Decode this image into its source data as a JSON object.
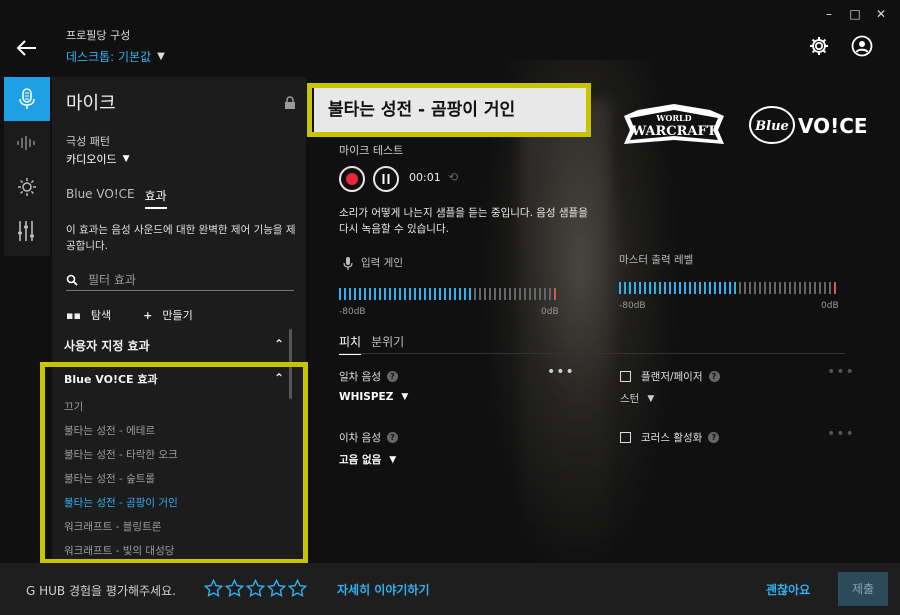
{
  "window": {
    "minimize": "–",
    "maximize": "□",
    "close": "✕"
  },
  "header": {
    "profile_label": "프로필당 구성",
    "profile_value": "데스크톱: 기본값"
  },
  "rail": {
    "items": [
      "microphone-icon",
      "waveform-icon",
      "sun-icon",
      "equalizer-icon"
    ],
    "active": 0
  },
  "panel": {
    "title": "마이크",
    "pattern_label": "극성 패턴",
    "pattern_value": "카디오이드",
    "tabs": [
      "Blue VO!CE",
      "효과"
    ],
    "active_tab": 1,
    "description": "이 효과는 음성 사운드에 대한 완벽한 제어 기능을 제공합니다.",
    "search_placeholder": "필터 효과",
    "explore_label": "탐색",
    "create_label": "만들기",
    "custom_section": "사용자 지정 효과",
    "bluevoice_section": "Blue VO!CE 효과",
    "effects": [
      "끄기",
      "불타는 성전 - 에테르",
      "불타는 성전 - 타락한 오크",
      "불타는 성전 - 숲트롤",
      "불타는 성전 - 곰팡이 거인",
      "워크래프트 - 블링트론",
      "워크래프트 - 빛의 대성당"
    ],
    "selected_effect": 4
  },
  "main": {
    "preset_title": "불타는 성전 - 곰팡이 거인",
    "logo_left": "WORLD WARCRAFT",
    "logo_right": "Blue VO!CE",
    "mic_test_label": "마이크 테스트",
    "timer": "00:01",
    "listen_text": "소리가 어떻게 나는지 샘플을 듣는 중입니다. 음성 샘플을 다시 녹음할 수 있습니다.",
    "input_gain_label": "입력 게인",
    "master_output_label": "마스터 출력 레벨",
    "input_min": "-80dB",
    "input_max": "0dB",
    "output_min": "-80dB",
    "output_max": "0dB",
    "input_level": 0.62,
    "output_level": 0.55,
    "subtabs": [
      "피치",
      "분위기"
    ],
    "active_subtab": 0,
    "primary_voice_label": "일차 음성",
    "primary_voice_value": "WHISPEZ",
    "secondary_voice_label": "이차 음성",
    "secondary_voice_value": "고음 없음",
    "flanger_label": "플랜저/페이저",
    "flanger_value": "스턴",
    "chorus_label": "코러스 활성화",
    "flanger_checked": false,
    "chorus_checked": false
  },
  "footer": {
    "rate_text": "G HUB 경험을 평가해주세요.",
    "star_count": 5,
    "tell_more": "자세히 이야기하기",
    "ok_label": "괜찮아요",
    "submit_label": "제출"
  },
  "colors": {
    "accent": "#2fb0ef",
    "highlight": "#c9c400",
    "record": "#e8283b"
  }
}
